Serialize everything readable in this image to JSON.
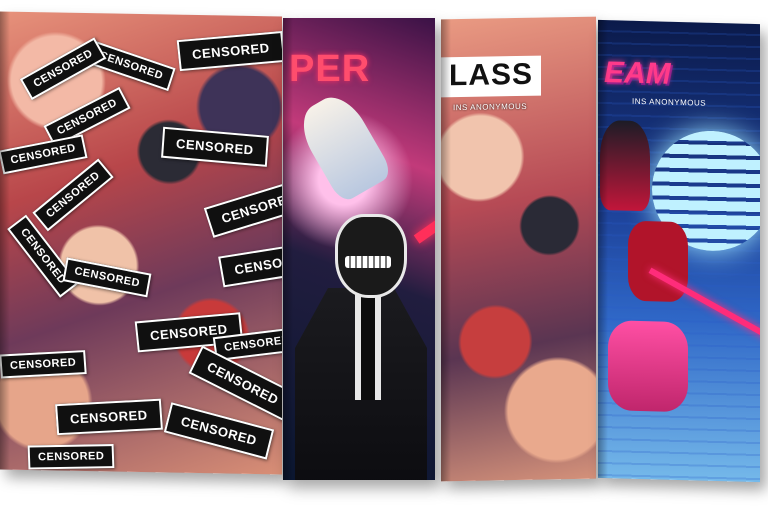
{
  "books": [
    {
      "id": "censored-edition",
      "stickers": [
        "CENSORED",
        "CENSORED",
        "CENSORED",
        "CENSORED",
        "CENSORED",
        "CENSORED",
        "CENSORED",
        "CENSORED",
        "CENSORED",
        "CENSORED",
        "CENSORED",
        "CENSORED",
        "CENSORED",
        "CENSORED",
        "CENSORED",
        "CENSORED",
        "CENSORED",
        "CENSORED"
      ]
    },
    {
      "id": "super-villains",
      "title": "PER"
    },
    {
      "id": "class",
      "title": "LASS",
      "subtitle": "INS ANONYMOUS"
    },
    {
      "id": "dream",
      "title": "EAM",
      "subtitle": "INS ANONYMOUS"
    }
  ],
  "colors": {
    "sticker_bg": "#101010",
    "villain_title": "#ff4d6d",
    "dream_title": "#ff3a8a",
    "dream_sky": "#1c3f96"
  }
}
